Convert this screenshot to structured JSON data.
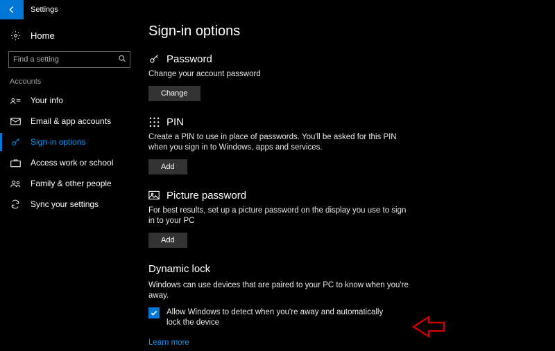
{
  "titlebar": {
    "app_title": "Settings"
  },
  "sidebar": {
    "home_label": "Home",
    "search_placeholder": "Find a setting",
    "group_label": "Accounts",
    "items": [
      {
        "label": "Your info"
      },
      {
        "label": "Email & app accounts"
      },
      {
        "label": "Sign-in options"
      },
      {
        "label": "Access work or school"
      },
      {
        "label": "Family & other people"
      },
      {
        "label": "Sync your settings"
      }
    ]
  },
  "main": {
    "title": "Sign-in options",
    "password": {
      "heading": "Password",
      "desc": "Change your account password",
      "button": "Change"
    },
    "pin": {
      "heading": "PIN",
      "desc": "Create a PIN to use in place of passwords. You'll be asked for this PIN when you sign in to Windows, apps and services.",
      "button": "Add"
    },
    "picture": {
      "heading": "Picture password",
      "desc": "For best results, set up a picture password on the display you use to sign in to your PC",
      "button": "Add"
    },
    "dynamic": {
      "heading": "Dynamic lock",
      "desc": "Windows can use devices that are paired to your PC to know when you're away.",
      "checkbox_label": "Allow Windows to detect when you're away and automatically lock the device",
      "checked": true,
      "link": "Learn more"
    }
  }
}
